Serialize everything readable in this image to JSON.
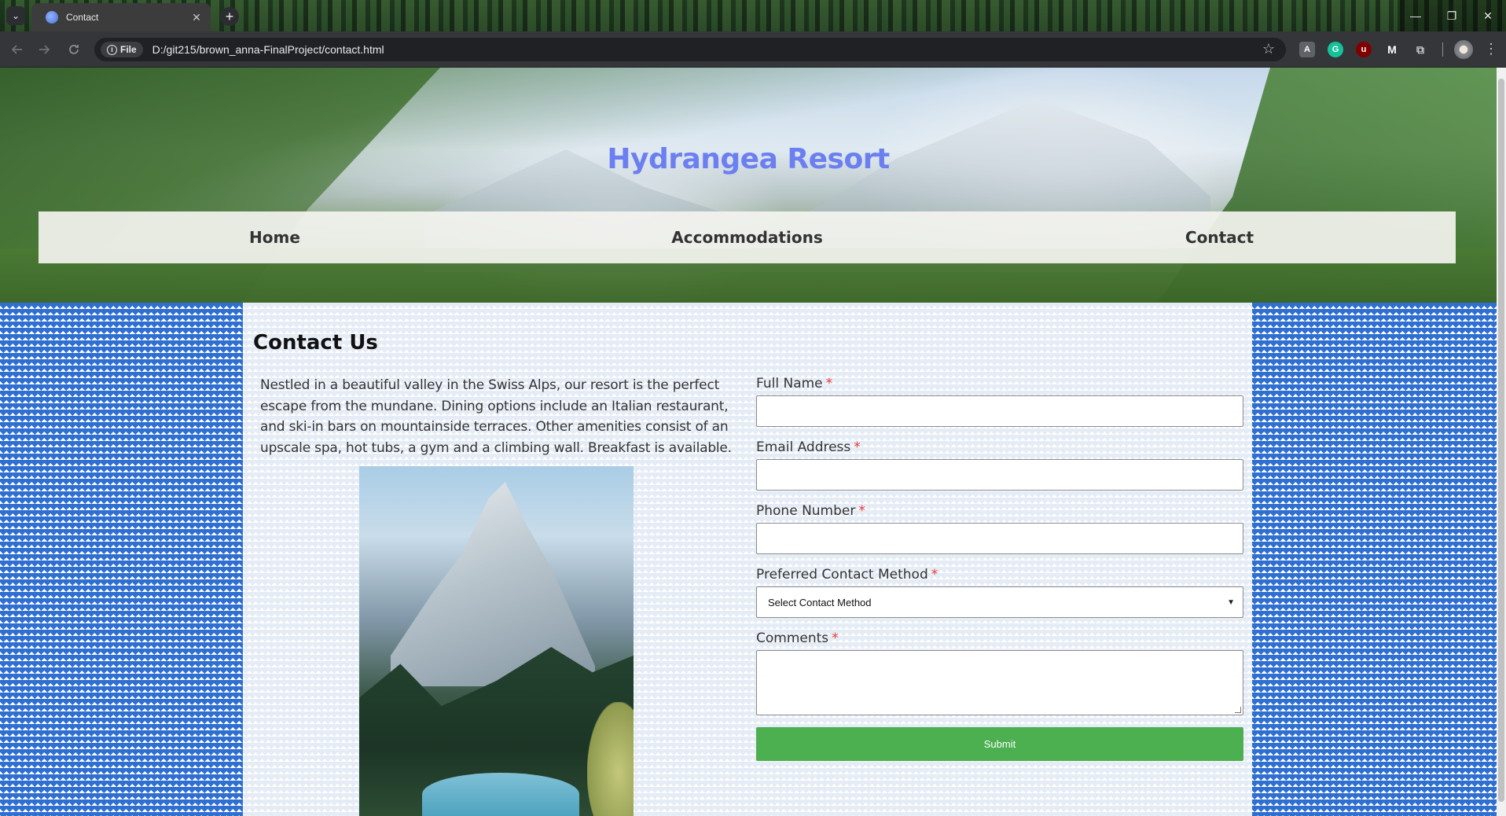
{
  "browser": {
    "tab_title": "Contact",
    "tab_list_glyph": "⌄",
    "tab_close_glyph": "✕",
    "new_tab_glyph": "+",
    "url_chip_label": "File",
    "url": "D:/git215/brown_anna-FinalProject/contact.html",
    "icons": [
      "tab-list-icon",
      "favicon-icon",
      "back-icon",
      "forward-icon",
      "reload-icon",
      "info-icon",
      "star-icon",
      "extension-icon",
      "profile-icon",
      "menu-icon"
    ],
    "window_controls": {
      "minimize": "—",
      "restore": "❐",
      "close": "✕"
    },
    "extensions": [
      {
        "name": "reader-extension",
        "glyph": "A",
        "color": "#5f6368"
      },
      {
        "name": "grammarly-extension",
        "glyph": "G",
        "color": "#15c39a"
      },
      {
        "name": "ublock-extension",
        "glyph": "u",
        "color": "#800000"
      },
      {
        "name": "m-extension",
        "glyph": "M",
        "color": "#35363a"
      },
      {
        "name": "puzzle-extension",
        "glyph": "⧉",
        "color": "#35363a"
      }
    ]
  },
  "site": {
    "title": "Hydrangea Resort",
    "title_color": "#6b7ff0",
    "nav": [
      {
        "label": "Home"
      },
      {
        "label": "Accommodations"
      },
      {
        "label": "Contact"
      }
    ]
  },
  "main": {
    "heading": "Contact Us",
    "intro": "Nestled in a beautiful valley in the Swiss Alps, our resort is the perfect escape from the mundane. Dining options include an Italian restaurant, and ski-in bars on mountainside terraces. Other amenities consist of an upscale spa, hot tubs, a gym and a climbing wall. Breakfast is available.",
    "pattern_color": "#2e6fd1"
  },
  "form": {
    "required_marker": "*",
    "full_name_label": "Full Name",
    "email_label": "Email Address",
    "phone_label": "Phone Number",
    "contact_method_label": "Preferred Contact Method",
    "contact_method_selected": "Select Contact Method",
    "comments_label": "Comments",
    "submit_label": "Submit",
    "submit_color": "#4caf50"
  }
}
